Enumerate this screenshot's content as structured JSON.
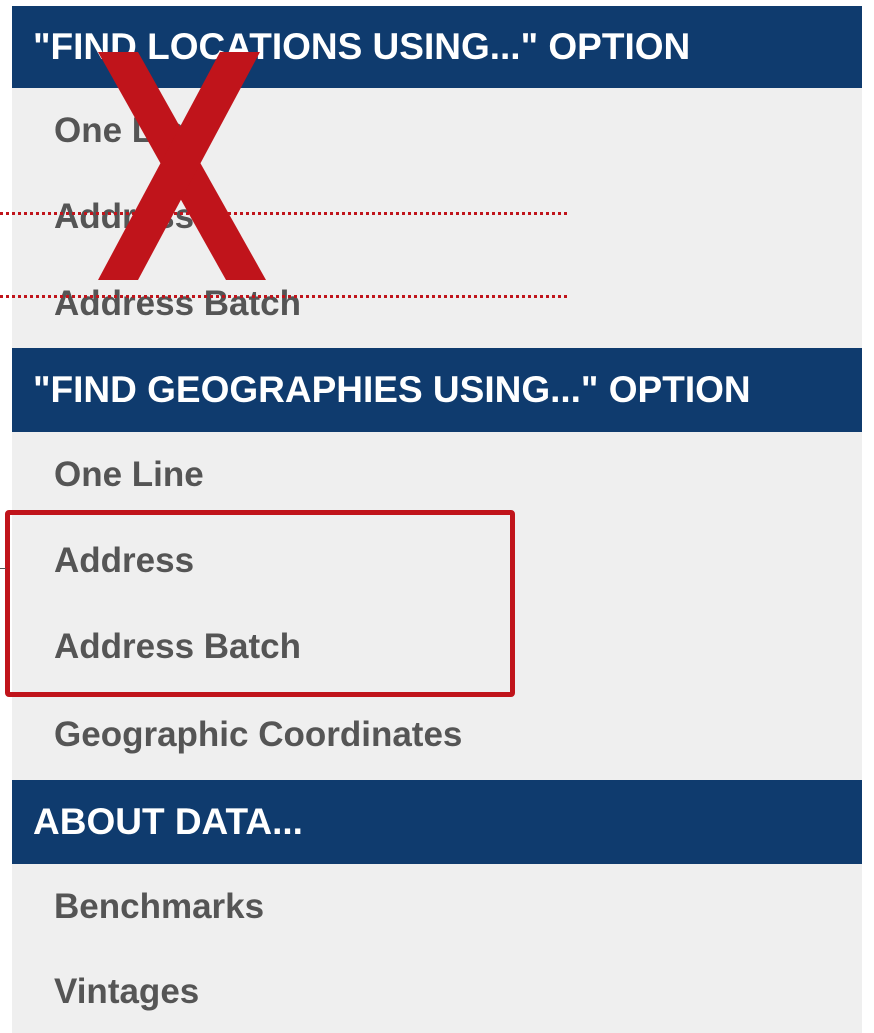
{
  "sections": [
    {
      "header": "\"FIND LOCATIONS USING...\" OPTION",
      "items": [
        "One Line",
        "Address",
        "Address Batch"
      ]
    },
    {
      "header": "\"FIND GEOGRAPHIES USING...\" OPTION",
      "items": [
        "One Line",
        "Address",
        "Address Batch",
        "Geographic Coordinates"
      ]
    },
    {
      "header": "ABOUT DATA...",
      "items": [
        "Benchmarks",
        "Vintages"
      ]
    }
  ],
  "annotations": {
    "x_mark_icon": "x-mark",
    "color": "#c0141b"
  },
  "colors": {
    "header_bg": "#0f3b6e",
    "header_text": "#ffffff",
    "panel_bg": "#efefef",
    "item_text": "#555555",
    "annotation_red": "#c0141b"
  }
}
